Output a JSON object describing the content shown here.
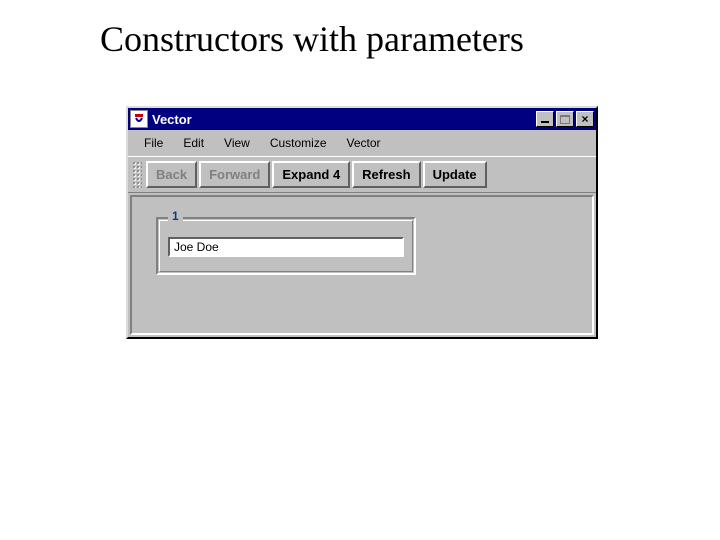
{
  "slide": {
    "title": "Constructors with parameters"
  },
  "window": {
    "title": "Vector",
    "menus": {
      "file": "File",
      "edit": "Edit",
      "view": "View",
      "customize": "Customize",
      "vector": "Vector"
    },
    "toolbar": {
      "back": "Back",
      "forward": "Forward",
      "expand": "Expand 4",
      "refresh": "Refresh",
      "update": "Update"
    },
    "group": {
      "label": "1",
      "value": "Joe Doe"
    }
  }
}
